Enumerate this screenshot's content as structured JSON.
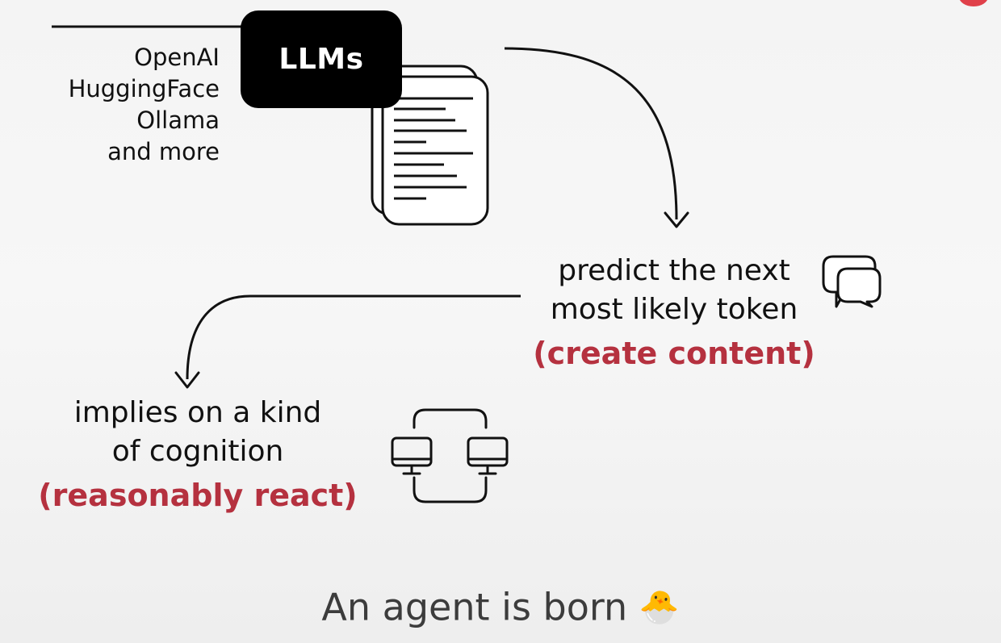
{
  "providers": {
    "line1": "OpenAI",
    "line2": "HuggingFace",
    "line3": "Ollama",
    "line4": "and more"
  },
  "llm_badge": "LLMs",
  "predict": {
    "line1": "predict the next",
    "line2": "most likely token",
    "highlight": "(create content)"
  },
  "cognition": {
    "line1": "implies on a kind",
    "line2": "of cognition",
    "highlight": "(reasonably react)"
  },
  "caption": {
    "text": "An agent is born",
    "emoji": "🐣"
  },
  "colors": {
    "highlight": "#b5313f",
    "badge_bg": "#000000",
    "record": "#e0404a"
  }
}
